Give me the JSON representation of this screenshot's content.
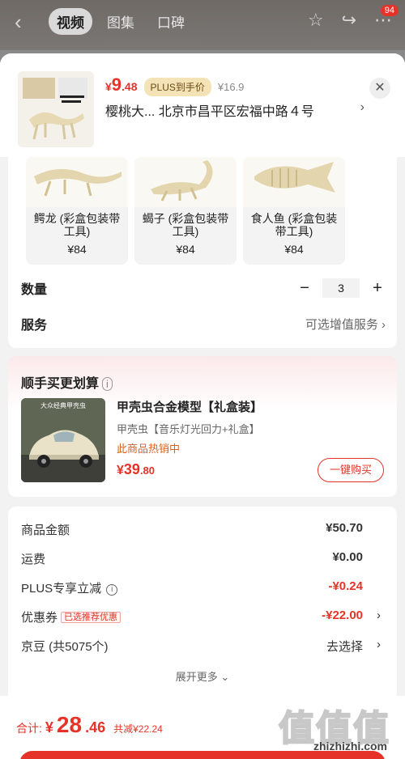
{
  "topbar": {
    "back_icon": "back-arrow",
    "tabs": [
      "视频",
      "图集",
      "口碑"
    ],
    "badge": "94"
  },
  "product": {
    "price_symbol": "¥",
    "price_int": "9",
    "price_dec": ".48",
    "plus_label": "PLUS到手价",
    "orig_price": "¥16.9",
    "address": "樱桃大...   北京市昌平区宏福中路４号",
    "address_arrow": "›",
    "close": "✕"
  },
  "variants": [
    {
      "name": "鳄龙 (彩盒包装带工具)",
      "price": "¥84"
    },
    {
      "name": "蝎子 (彩盒包装带工具)",
      "price": "¥84"
    },
    {
      "name": "食人鱼 (彩盒包装带工具)",
      "price": "¥84"
    }
  ],
  "quantity": {
    "label": "数量",
    "minus": "−",
    "value": "3",
    "plus": "+"
  },
  "service": {
    "label": "服务",
    "value": "可选增值服务",
    "arrow": "›"
  },
  "addon": {
    "title": "顺手买更划算",
    "info": "i",
    "item_title": "甲壳虫合金模型【礼盒装】",
    "item_sub": "甲壳虫【音乐灯光回力+礼盒】",
    "item_hot": "此商品热销中",
    "price_symbol": "¥",
    "price_int": "39",
    "price_dec": ".80",
    "buy_label": "一键购买",
    "image_caption": "大众经典甲壳虫"
  },
  "costs": {
    "goods_label": "商品金额",
    "goods_value": "¥50.70",
    "shipping_label": "运费",
    "shipping_value": "¥0.00",
    "plus_label": "PLUS专享立减",
    "plus_value": "-¥0.24",
    "coupon_label": "优惠券",
    "coupon_tag": "已选推荐优惠",
    "coupon_value": "-¥22.00",
    "beans_label": "京豆 (共5075个)",
    "beans_value": "去选择",
    "arrow": "›",
    "expand_label": "展开更多 ⌄"
  },
  "bottom": {
    "total_label": "合计:",
    "symbol": "¥",
    "total_int": "28",
    "total_dec": ".46",
    "saved": "共减¥22.24"
  },
  "watermark": {
    "big": "值值值",
    "small": "zhizhizhi.com"
  }
}
